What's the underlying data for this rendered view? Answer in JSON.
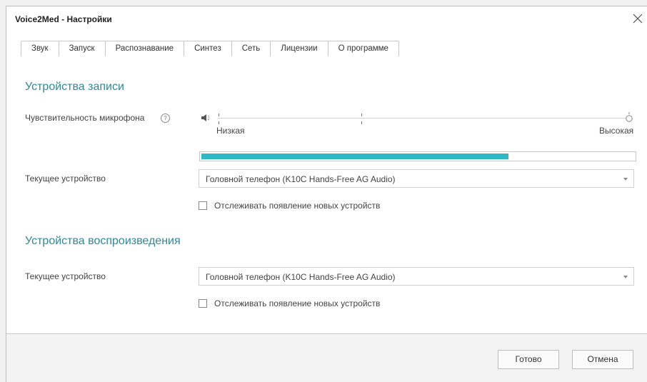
{
  "window": {
    "title": "Voice2Med - Настройки"
  },
  "tabs": [
    {
      "label": "Звук",
      "active": true
    },
    {
      "label": "Запуск",
      "active": false
    },
    {
      "label": "Распознавание",
      "active": false
    },
    {
      "label": "Синтез",
      "active": false
    },
    {
      "label": "Сеть",
      "active": false
    },
    {
      "label": "Лицензии",
      "active": false
    },
    {
      "label": "О программе",
      "active": false
    }
  ],
  "recording": {
    "section_title": "Устройства записи",
    "sensitivity_label": "Чувствительность микрофона",
    "help_glyph": "?",
    "slider_low_label": "Низкая",
    "slider_high_label": "Высокая",
    "sensitivity_level": 1.0,
    "input_level_fraction": 0.71,
    "device_label": "Текущее устройство",
    "device_value": "Головной телефон (K10C Hands-Free AG Audio)",
    "monitor_label": "Отслеживать появление новых устройств",
    "monitor_checked": false
  },
  "playback": {
    "section_title": "Устройства воспроизведения",
    "device_label": "Текущее устройство",
    "device_value": "Головной телефон (K10C Hands-Free AG Audio)",
    "monitor_label": "Отслеживать появление новых устройств",
    "monitor_checked": false
  },
  "buttons": {
    "ok_label": "Готово",
    "cancel_label": "Отмена"
  },
  "colors": {
    "accent": "#2c8a9b",
    "level": "#2cb8c4"
  }
}
